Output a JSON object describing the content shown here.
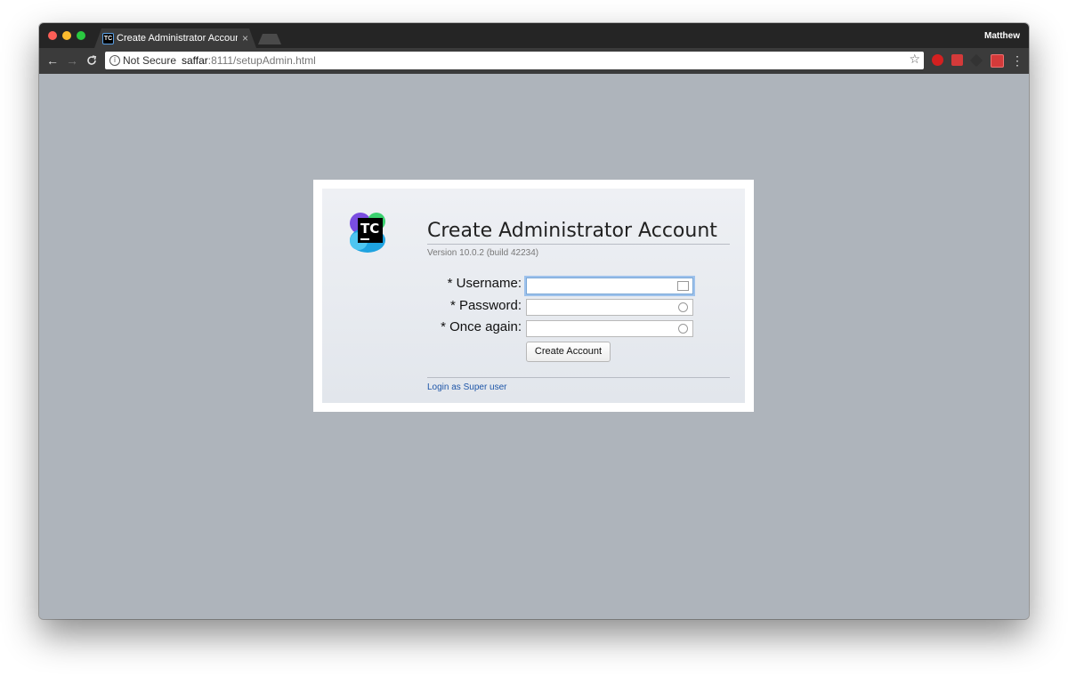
{
  "browser": {
    "tab_title": "Create Administrator Account",
    "tab_close": "×",
    "favicon_text": "TC",
    "profile_name": "Matthew",
    "nav": {
      "back": "←",
      "forward": "→",
      "reload": "C"
    },
    "security_label": "Not Secure",
    "url_host": "saffar",
    "url_rest": ":8111/setupAdmin.html",
    "star": "☆",
    "menu": "⋮"
  },
  "page": {
    "logo_text": "TC",
    "title": "Create Administrator Account",
    "version": "Version 10.0.2 (build 42234)",
    "fields": {
      "username_label": "* Username:",
      "password_label": "* Password:",
      "confirm_label": "* Once again:"
    },
    "submit_label": "Create Account",
    "super_user_link": "Login as Super user"
  },
  "colors": {
    "page_background": "#aeb4bb",
    "link": "#1e56a8",
    "focus_ring": "#9ec2ec"
  }
}
